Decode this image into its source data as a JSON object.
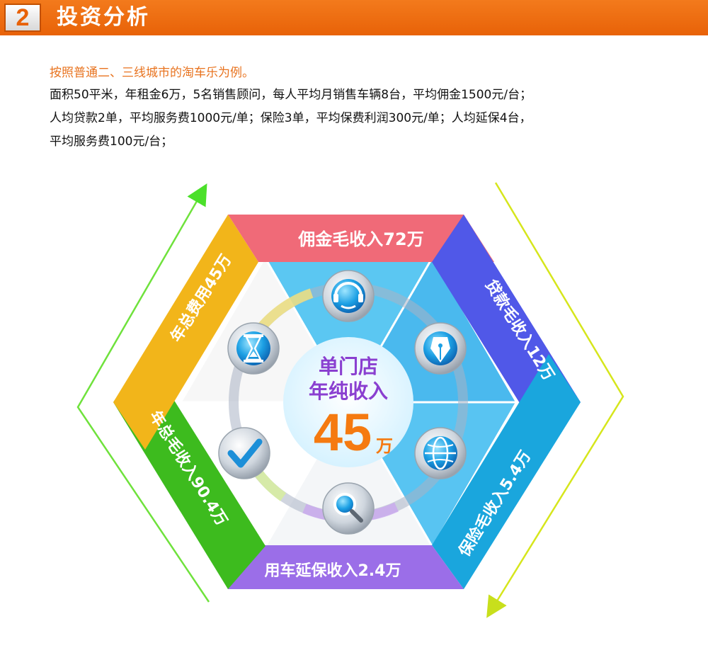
{
  "header": {
    "number": "2",
    "title": "投资分析"
  },
  "intro": "按照普通二、三线城市的淘车乐为例。",
  "paragraph": [
    "面积50平米，年租金6万，5名销售顾问，每人平均月销售车辆8台，平均佣金1500元/台；",
    "人均贷款2单，平均服务费1000元/单；保险3单，平均保费利润300元/单；人均延保4台，",
    "平均服务费100元/台；"
  ],
  "center": {
    "line1": "单门店",
    "line2": "年纯收入",
    "value": "45",
    "unit": "万"
  },
  "segments": [
    {
      "label": "佣金毛收入72万",
      "color": "#f06a78"
    },
    {
      "label": "贷款毛收入12万",
      "color": "#4f56e8"
    },
    {
      "label": "保险毛收入5.4万",
      "color": "#1aa6dd"
    },
    {
      "label": "用车延保收入2.4万",
      "color": "#9b6ee8"
    },
    {
      "label": "年总毛收入90.4万",
      "color": "#3dbb1e"
    },
    {
      "label": "年总费用45万",
      "color": "#f2b51a"
    }
  ],
  "icons": [
    "headset-icon",
    "pen-nib-icon",
    "globe-icon",
    "magnifier-icon",
    "checkmark-icon",
    "hourglass-icon"
  ],
  "colors": {
    "header": "#e86208",
    "intro": "#e8731f",
    "center_value": "#f57a10",
    "center_text": "#8a3fd0"
  }
}
